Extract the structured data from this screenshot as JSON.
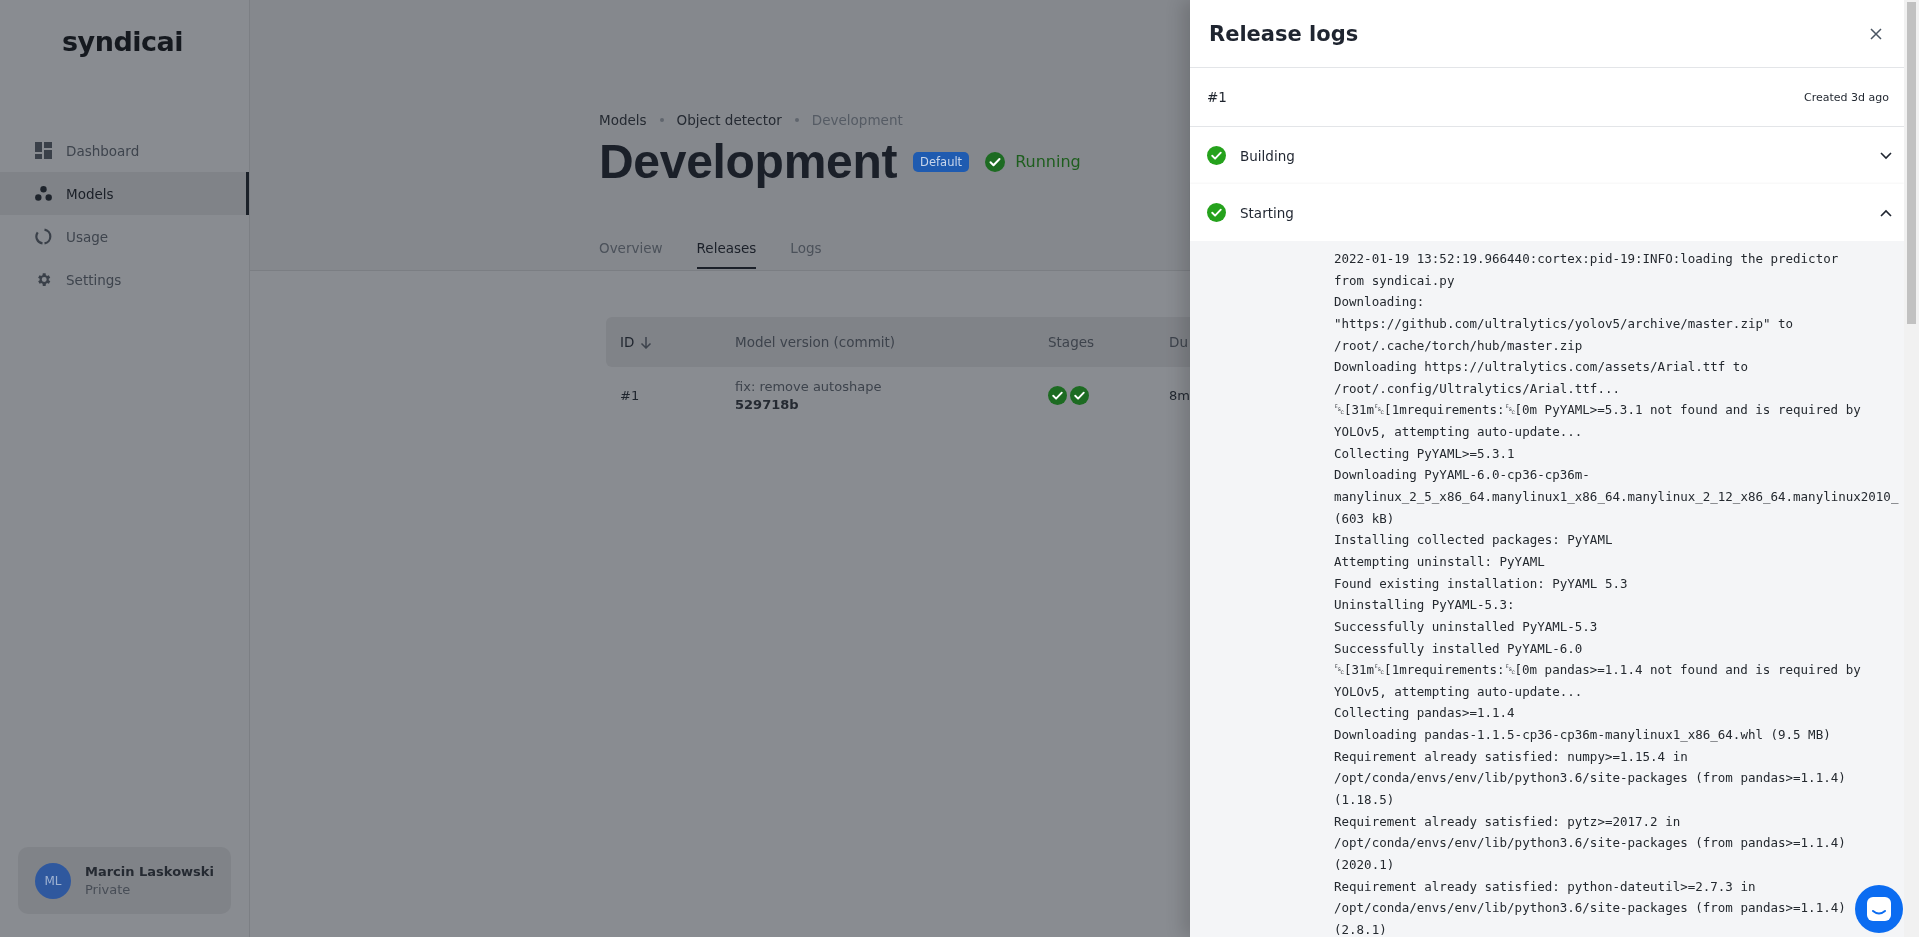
{
  "sidebar": {
    "logo": "syndicai",
    "items": [
      {
        "label": "Dashboard",
        "selected": false
      },
      {
        "label": "Models",
        "selected": true
      },
      {
        "label": "Usage",
        "selected": false
      },
      {
        "label": "Settings",
        "selected": false
      }
    ],
    "user": {
      "initials": "ML",
      "name": "Marcin Laskowski",
      "plan": "Private"
    }
  },
  "breadcrumbs": [
    "Models",
    "Object detector",
    "Development"
  ],
  "page": {
    "title": "Development",
    "badge": "Default",
    "status": "Running"
  },
  "tabs": [
    {
      "label": "Overview",
      "selected": false
    },
    {
      "label": "Releases",
      "selected": true
    },
    {
      "label": "Logs",
      "selected": false
    }
  ],
  "table": {
    "columns": [
      "ID",
      "Model version (commit)",
      "Stages",
      "Du"
    ],
    "rows": [
      {
        "id": "#1",
        "message": "fix: remove autoshape",
        "commit": "529718b",
        "stages": [
          {
            "kind": "success"
          },
          {
            "kind": "success"
          }
        ],
        "column_4": "8m"
      }
    ]
  },
  "release_logs": {
    "title": "Release logs",
    "release_id": "#1",
    "created": "Created 3d ago",
    "stages": [
      {
        "name": "Building",
        "kind": "success",
        "expanded": false
      },
      {
        "name": "Starting",
        "kind": "success",
        "expanded": true
      }
    ],
    "log_lines": [
      "2022-01-19 13:52:19.966440:cortex:pid-19:INFO:loading the predictor",
      "from syndicai.py",
      "Downloading:",
      "\"https://github.com/ultralytics/yolov5/archive/master.zip\" to",
      "/root/.cache/torch/hub/master.zip",
      "Downloading https://ultralytics.com/assets/Arial.ttf to",
      "/root/.config/Ultralytics/Arial.ttf...",
      "␛[31m␛[1mrequirements:␛[0m PyYAML>=5.3.1 not found and is required by",
      "YOLOv5, attempting auto-update...",
      "Collecting PyYAML>=5.3.1",
      "Downloading PyYAML-6.0-cp36-cp36m-",
      "manylinux_2_5_x86_64.manylinux1_x86_64.manylinux_2_12_x86_64.manylinux2010_",
      "(603 kB)",
      "Installing collected packages: PyYAML",
      "Attempting uninstall: PyYAML",
      "Found existing installation: PyYAML 5.3",
      "Uninstalling PyYAML-5.3:",
      "Successfully uninstalled PyYAML-5.3",
      "Successfully installed PyYAML-6.0",
      "␛[31m␛[1mrequirements:␛[0m pandas>=1.1.4 not found and is required by",
      "YOLOv5, attempting auto-update...",
      "Collecting pandas>=1.1.4",
      "Downloading pandas-1.1.5-cp36-cp36m-manylinux1_x86_64.whl (9.5 MB)",
      "Requirement already satisfied: numpy>=1.15.4 in",
      "/opt/conda/envs/env/lib/python3.6/site-packages (from pandas>=1.1.4)",
      "(1.18.5)",
      "Requirement already satisfied: pytz>=2017.2 in",
      "/opt/conda/envs/env/lib/python3.6/site-packages (from pandas>=1.1.4)",
      "(2020.1)",
      "Requirement already satisfied: python-dateutil>=2.7.3 in",
      "/opt/conda/envs/env/lib/python3.6/site-packages (from pandas>=1.1.4)",
      "(2.8.1)"
    ]
  }
}
